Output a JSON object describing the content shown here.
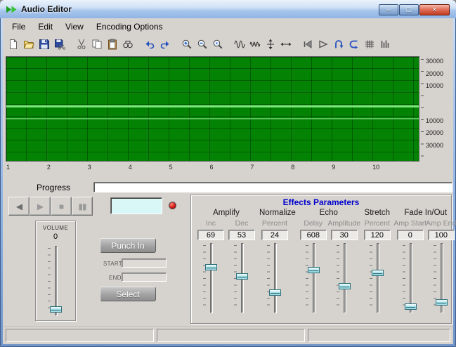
{
  "window": {
    "title": "Audio Editor",
    "min_glyph": "–",
    "max_glyph": "□",
    "close_glyph": "×"
  },
  "menu": {
    "items": [
      "File",
      "Edit",
      "View",
      "Encoding Options"
    ]
  },
  "toolbar": {
    "groups": [
      [
        "new-file",
        "open-folder",
        "save",
        "save-as"
      ],
      [
        "cut",
        "copy",
        "paste",
        "find"
      ],
      [
        "undo",
        "redo"
      ],
      [
        "zoom-in",
        "zoom-out",
        "zoom-actual"
      ],
      [
        "waveform",
        "waveform-dense",
        "fit-vertical",
        "fit-horizontal"
      ],
      [
        "play-reverse",
        "amplifier",
        "u-turn",
        "trim",
        "blocks",
        "levels"
      ]
    ]
  },
  "waveform": {
    "scale_top": [
      "30000",
      "20000",
      "10000"
    ],
    "scale_bottom": [
      "10000",
      "20000",
      "30000"
    ],
    "time_ticks": [
      "1",
      "2",
      "3",
      "4",
      "5",
      "6",
      "7",
      "8",
      "9",
      "10"
    ]
  },
  "progress": {
    "label": "Progress"
  },
  "transport": {
    "buttons": [
      "rewind",
      "play",
      "stop",
      "pause"
    ]
  },
  "monitor": {
    "value": ""
  },
  "volume": {
    "label": "VOLUME",
    "value": "0",
    "thumb": 0.95
  },
  "punch": {
    "punch_in": "Punch In",
    "start_label": "START",
    "start_value": "",
    "end_label": "END",
    "end_value": "",
    "select": "Select"
  },
  "effects": {
    "title": "Effects Parameters",
    "groups": [
      {
        "name": "Amplify",
        "params": [
          {
            "label": "Inc",
            "value": "69",
            "thumb": 0.33
          },
          {
            "label": "Dec",
            "value": "53",
            "thumb": 0.47
          }
        ]
      },
      {
        "name": "Normalize",
        "params": [
          {
            "label": "Percent",
            "value": "24",
            "thumb": 0.72
          }
        ]
      },
      {
        "name": "Echo",
        "params": [
          {
            "label": "Delay",
            "value": "608",
            "thumb": 0.37
          },
          {
            "label": "Amplitude",
            "value": "30",
            "thumb": 0.63
          }
        ]
      },
      {
        "name": "Stretch",
        "params": [
          {
            "label": "Percent",
            "value": "120",
            "thumb": 0.42
          }
        ]
      },
      {
        "name": "Fade In/Out",
        "params": [
          {
            "label": "Amp Start",
            "value": "0",
            "thumb": 0.95
          },
          {
            "label": "Amp End",
            "value": "100",
            "thumb": 0.88
          }
        ]
      }
    ]
  },
  "statusbar": {
    "panels": [
      "",
      "",
      ""
    ]
  },
  "colors": {
    "wave_bg": "#038203",
    "wave_axis": "#7de67d",
    "effects_title_blue": "#0000cd",
    "led_red": "#d01010",
    "monitor_cyan": "#d9f7f7"
  }
}
